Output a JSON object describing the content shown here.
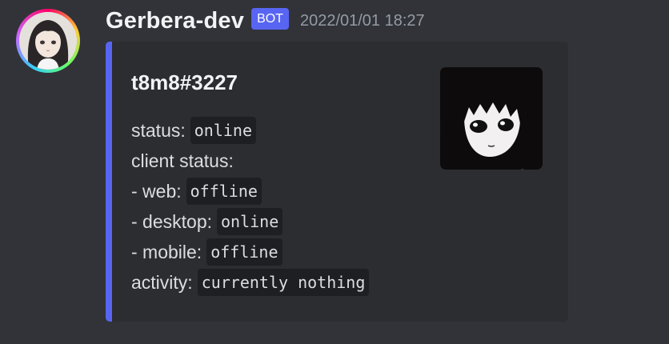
{
  "author": {
    "username": "Gerbera-dev",
    "bot_tag": "BOT",
    "timestamp": "2022/01/01 18:27",
    "avatar_icon": "anime-girl-avatar-icon"
  },
  "embed": {
    "accent_color": "#5865f2",
    "title": "t8m8#3227",
    "thumbnail_icon": "anime-girl-thumbnail-icon",
    "lines": [
      {
        "label": "status:",
        "value": "online"
      },
      {
        "label": "client status:",
        "value": ""
      },
      {
        "label": "- web:",
        "value": "offline"
      },
      {
        "label": "- desktop:",
        "value": "online"
      },
      {
        "label": "- mobile:",
        "value": "offline"
      },
      {
        "label": "activity:",
        "value": "currently nothing"
      }
    ]
  }
}
